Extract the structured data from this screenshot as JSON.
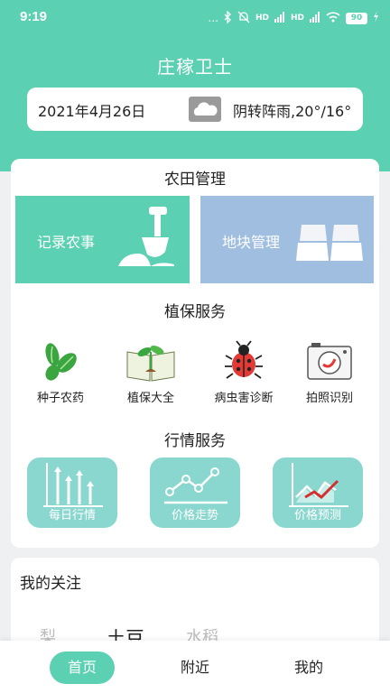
{
  "status": {
    "time": "9:19",
    "dots": "...",
    "signal1": "HD",
    "signal2": "HD",
    "battery": "90"
  },
  "app": {
    "title": "庄稼卫士"
  },
  "weather": {
    "date": "2021年4月26日",
    "description": "阴转阵雨,20°/16°",
    "icon": "cloud-icon"
  },
  "farm_management": {
    "title": "农田管理",
    "record_label": "记录农事",
    "record_icon": "shovel-icon",
    "plot_label": "地块管理",
    "plot_icon": "land-plot-icon"
  },
  "plant_protection": {
    "title": "植保服务",
    "items": [
      {
        "label": "种子农药",
        "icon": "seed-icon"
      },
      {
        "label": "植保大全",
        "icon": "book-sprout-icon"
      },
      {
        "label": "病虫害诊断",
        "icon": "bug-icon"
      },
      {
        "label": "拍照识别",
        "icon": "camera-icon"
      }
    ]
  },
  "market_service": {
    "title": "行情服务",
    "items": [
      {
        "label": "每日行情",
        "icon": "bar-chart-icon"
      },
      {
        "label": "价格走势",
        "icon": "line-chart-icon"
      },
      {
        "label": "价格预测",
        "icon": "forecast-chart-icon"
      }
    ]
  },
  "follow": {
    "title": "我的关注",
    "tabs": [
      "梨",
      "土豆",
      "水稻"
    ]
  },
  "bottom_nav": {
    "items": [
      "首页",
      "附近",
      "我的"
    ],
    "active": "首页"
  },
  "colors": {
    "primary": "#5cd0b3",
    "plot_blue": "#a0bfe0",
    "market_tile": "#8ad7cf"
  }
}
